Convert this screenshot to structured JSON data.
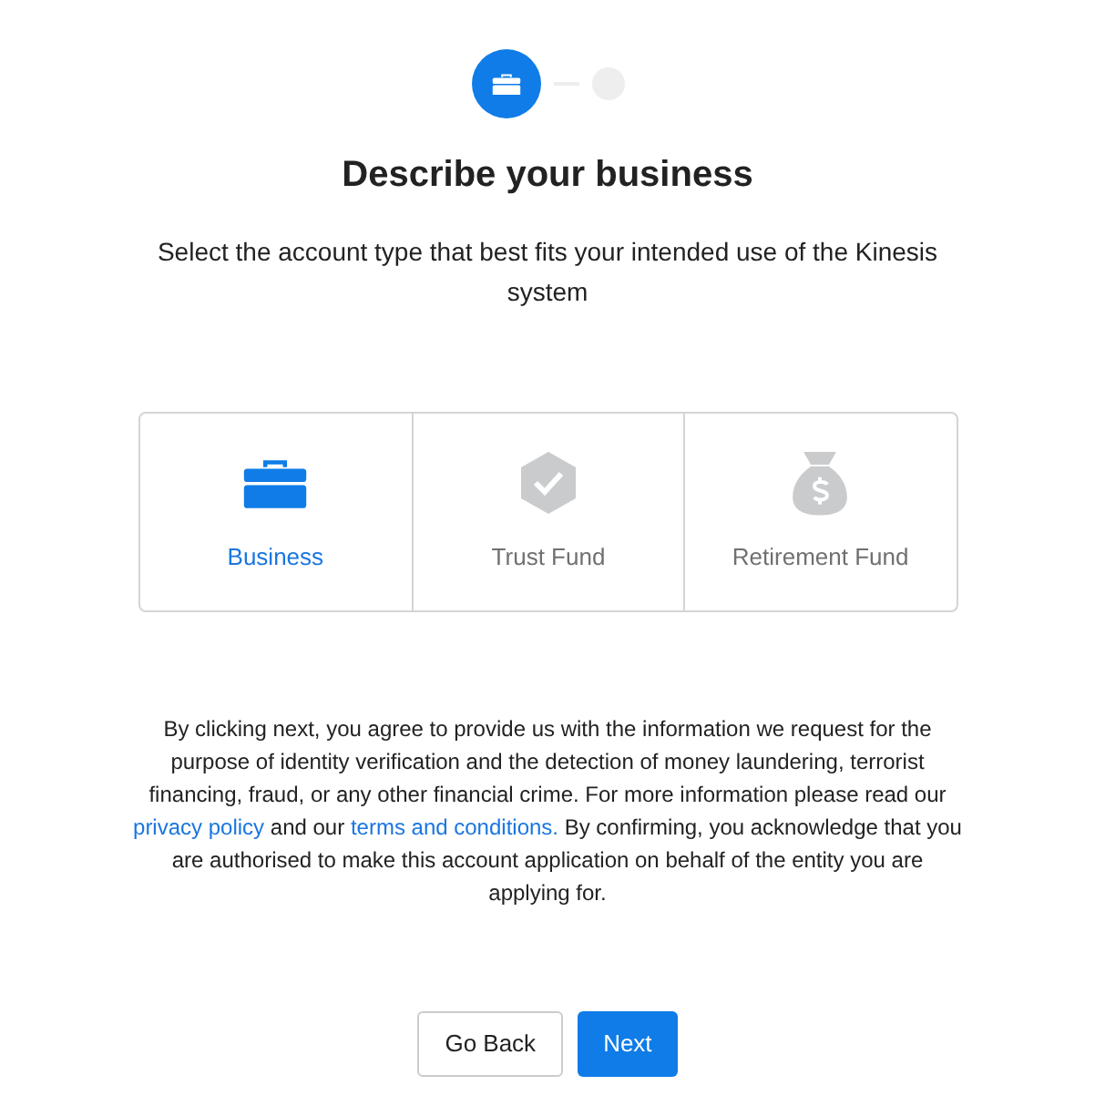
{
  "steps": [
    {
      "kind": "briefcase",
      "selected": true
    },
    {
      "kind": "blank",
      "selected": false
    }
  ],
  "title": "Describe your business",
  "subtitle": "Select the account type that best fits your intended use of the Kinesis system",
  "options": [
    {
      "kind": "briefcase",
      "label": "Business",
      "selected": true
    },
    {
      "kind": "shield",
      "label": "Trust Fund",
      "selected": false
    },
    {
      "kind": "moneybag",
      "label": "Retirement Fund",
      "selected": false
    }
  ],
  "disclaimer": {
    "before": "By clicking next, you agree to provide us with the information we request for the purpose of identity verification and the detection of money laundering, terrorist financing, fraud, or any other financial crime. For more information please read our",
    "link_1": "privacy policy",
    "middle": "and our",
    "link_2": "terms and conditions.",
    "after": "By confirming, you acknowledge that you are authorised to make this account application on behalf of the entity you are applying for."
  },
  "buttons": [
    {
      "kind": "secondary",
      "label": "Go Back"
    },
    {
      "kind": "primary",
      "label": "Next"
    }
  ]
}
